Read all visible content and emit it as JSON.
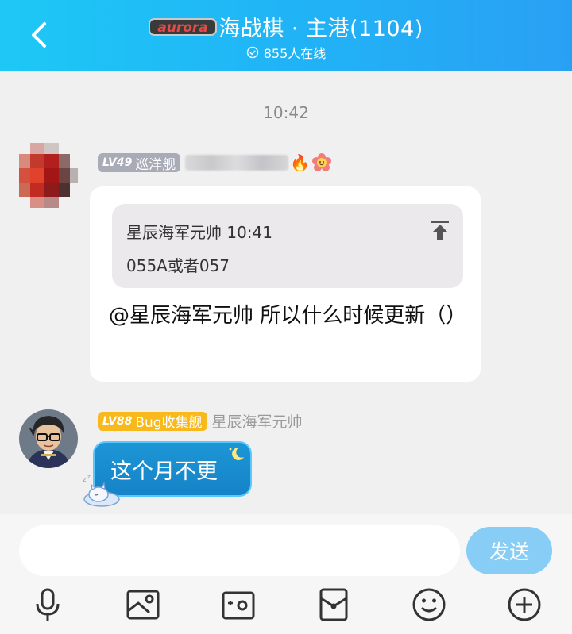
{
  "header": {
    "logo_text": "aurora",
    "title": "海战棋 · 主港(1104)",
    "online": "855人在线"
  },
  "chat": {
    "time": "10:42",
    "messages": [
      {
        "level": "LV49",
        "rank": "巡洋舰",
        "quote": {
          "author_time": "星辰海军元帅 10:41",
          "text": "055A或者057"
        },
        "text": "@星辰海军元帅 所以什么时候更新（）"
      },
      {
        "level": "LV88",
        "rank": "Bug收集舰",
        "sender": "星辰海军元帅",
        "text": "这个月不更"
      }
    ]
  },
  "input": {
    "value": "",
    "send_label": "发送"
  },
  "colors": {
    "header_accent": "#20b4f6",
    "send_button": "#87cdf5",
    "badge_gray": "#a9abb6",
    "badge_yellow": "#f7b91b",
    "bubble_blue": "#1583c7"
  },
  "icons": [
    "back-icon",
    "online-check-icon",
    "fire-icon",
    "flower-emoji-icon",
    "jump-to-quote-icon",
    "microphone-icon",
    "image-icon",
    "camera-icon",
    "red-packet-icon",
    "emoji-icon",
    "plus-icon"
  ]
}
